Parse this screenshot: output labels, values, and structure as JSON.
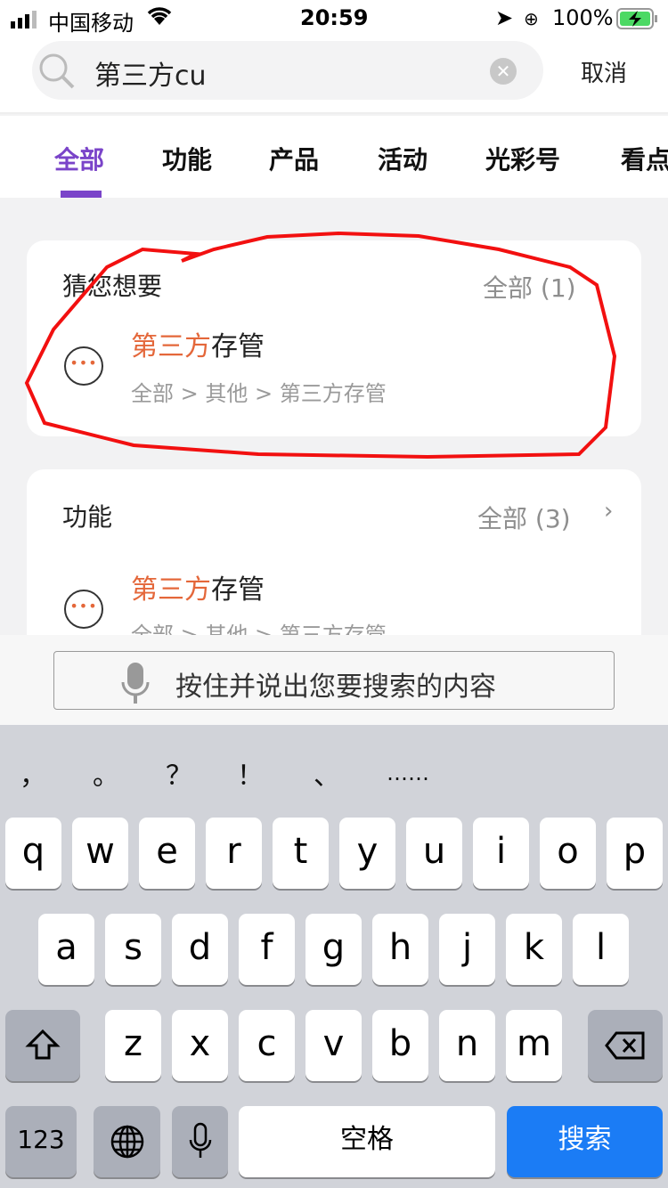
{
  "status": {
    "carrier": "中国移动",
    "time": "20:59",
    "battery": "100%"
  },
  "search": {
    "query": "第三方cu",
    "cancel": "取消"
  },
  "tabs": [
    "全部",
    "功能",
    "产品",
    "活动",
    "光彩号",
    "看点"
  ],
  "active_tab": "全部",
  "accent": "#7a44c9",
  "highlight": "#e4673a",
  "sections": [
    {
      "title": "猜您想要",
      "more": "全部 (1)",
      "item": {
        "hl": "第三方",
        "rest": "存管",
        "path": "全部 > 其他 > 第三方存管"
      }
    },
    {
      "title": "功能",
      "more": "全部 (3)",
      "item": {
        "hl": "第三方",
        "rest": "存管",
        "path": "全部 > 其他 > 第三方存管"
      }
    }
  ],
  "voice": {
    "label": "按住并说出您要搜索的内容"
  },
  "keyboard": {
    "punct": [
      "，",
      "。",
      "？",
      "！",
      "、",
      "……"
    ],
    "row1": [
      "q",
      "w",
      "e",
      "r",
      "t",
      "y",
      "u",
      "i",
      "o",
      "p"
    ],
    "row2": [
      "a",
      "s",
      "d",
      "f",
      "g",
      "h",
      "j",
      "k",
      "l"
    ],
    "row3": [
      "z",
      "x",
      "c",
      "v",
      "b",
      "n",
      "m"
    ],
    "num": "123",
    "space": "空格",
    "search": "搜索"
  }
}
